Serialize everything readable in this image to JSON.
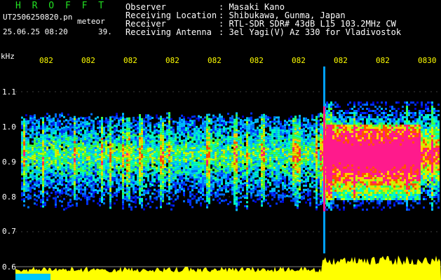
{
  "header": {
    "app_title": "H R O F F T",
    "file_name": "UT2506250820.pn",
    "meteor_label": "meteor",
    "date_time": "25.06.25 08:20",
    "count": "39.",
    "fields": [
      {
        "label": "Observer",
        "value": ": Masaki Kano"
      },
      {
        "label": "Receiving Location",
        "value": ": Shibukawa, Gunma, Japan"
      },
      {
        "label": "Receiver",
        "value": ": RTL-SDR SDR# 43dB L15 103.2MHz CW"
      },
      {
        "label": "Receiving Antenna",
        "value": ": 3el Yagi(V) Az 330 for Vladivostok"
      }
    ]
  },
  "y_axis": {
    "unit": "kHz",
    "ticks": [
      "1.1",
      "1.0",
      "0.9",
      "0.8",
      "0.7",
      "0.6"
    ]
  },
  "time_axis": {
    "ticks": [
      "082",
      "082",
      "082",
      "082",
      "082",
      "082",
      "082",
      "082",
      "082",
      "0830"
    ]
  },
  "colors": {
    "background": "#000000",
    "title": "#22e022",
    "tick_labels": "#ffff00",
    "power_trace": "#ffff00",
    "hot_signal": "#ff1a8c"
  }
}
